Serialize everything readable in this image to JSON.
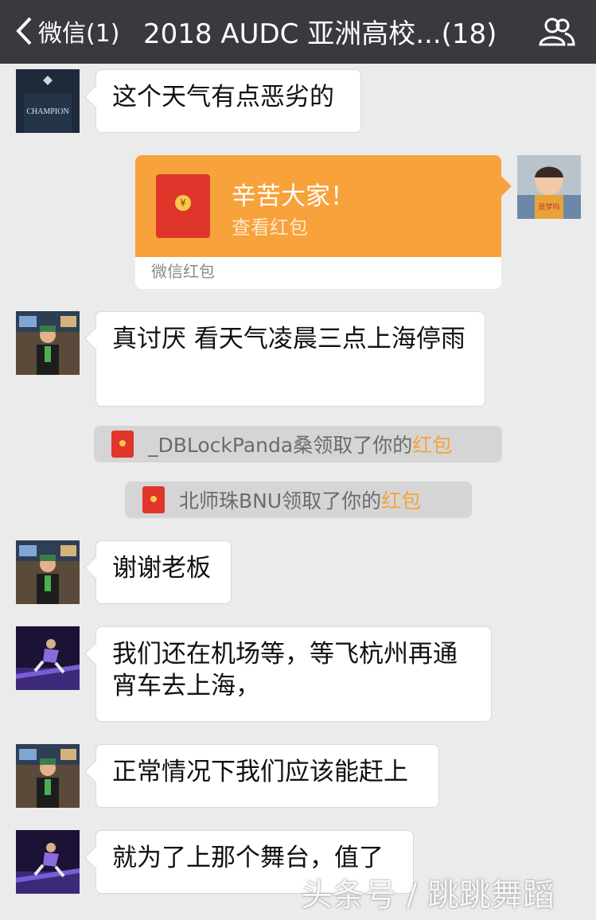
{
  "header": {
    "back_label": "微信(1)",
    "title": "2018 AUDC 亚洲高校...(18)"
  },
  "messages": [
    {
      "text": "这个天气有点恶劣的"
    },
    {
      "text": "真讨厌   看天气凌晨三点上海停雨"
    },
    {
      "text": "谢谢老板"
    },
    {
      "text": "我们还在机场等，等飞杭州再通宵车去上海，"
    },
    {
      "text": "正常情况下我们应该能赶上"
    },
    {
      "text": "就为了上那个舞台，值了"
    }
  ],
  "red_packet": {
    "title": "辛苦大家！",
    "subtitle": "查看红包",
    "footer": "微信红包",
    "coin_glyph": "¥"
  },
  "system_notices": [
    {
      "name": "_DBLockPanda桑",
      "middle": "领取了你的",
      "link": "红包"
    },
    {
      "name": "北师珠BNU",
      "middle": "领取了你的",
      "link": "红包"
    }
  ],
  "avatars": {
    "avatar_champion_text": "CHAMPION",
    "kid_caption": "是梦吗"
  },
  "watermark": "头条号 / 跳跳舞蹈",
  "colors": {
    "header_bg": "#393a3f",
    "chat_bg": "#ebebeb",
    "red_packet_orange": "#f7a23b",
    "highlight": "#f6a33d"
  }
}
